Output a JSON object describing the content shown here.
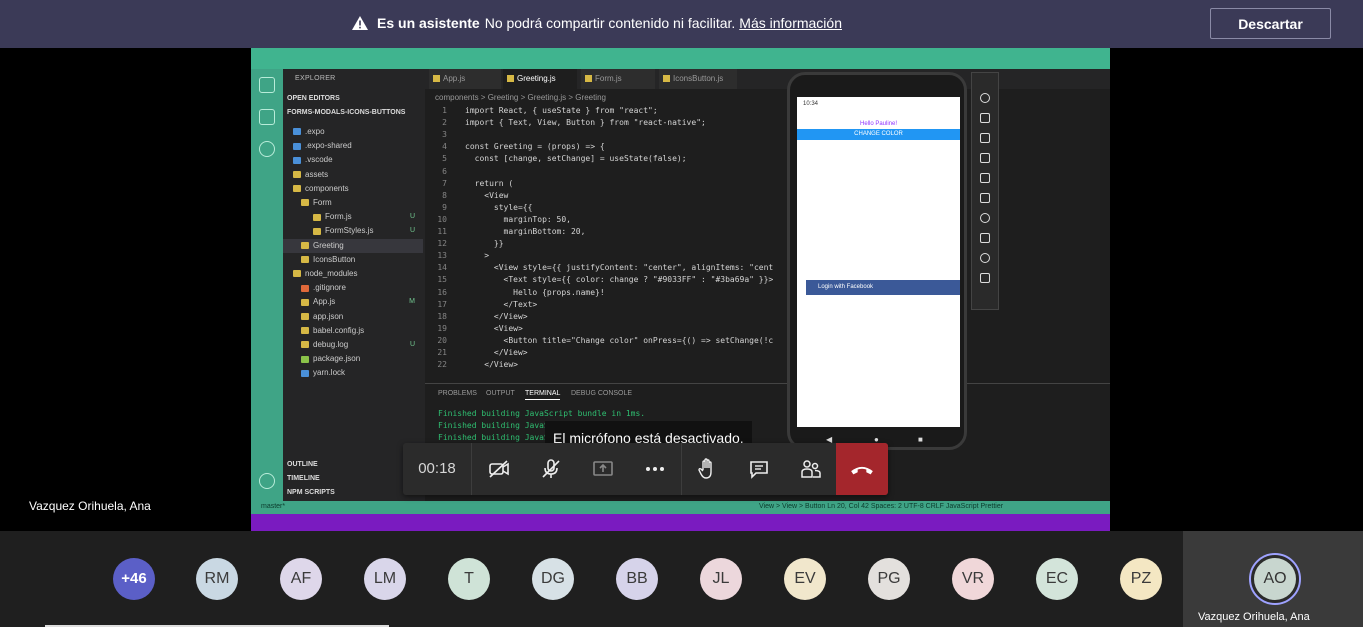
{
  "banner": {
    "icon": "warning-icon",
    "bold": "Es un asistente",
    "message": "No podrá compartir contenido ni facilitar.",
    "link": "Más información",
    "dismiss_label": "Descartar"
  },
  "vscode": {
    "explorer_title": "EXPLORER",
    "open_editors": "OPEN EDITORS",
    "project": "FORMS-MODALS-ICONS-BUTTONS",
    "tree": [
      {
        "label": ".expo",
        "status": "",
        "color": "#4a90d9"
      },
      {
        "label": ".expo-shared",
        "status": "",
        "color": "#4a90d9"
      },
      {
        "label": ".vscode",
        "status": "",
        "color": "#4a90d9"
      },
      {
        "label": "assets",
        "status": "",
        "color": "#d6b845"
      },
      {
        "label": "components",
        "status": "",
        "color": "#d6b845"
      },
      {
        "label": "Form",
        "status": "",
        "color": "#d6b845"
      },
      {
        "label": "Form.js",
        "status": "U",
        "color": "#d6b845"
      },
      {
        "label": "FormStyles.js",
        "status": "U",
        "color": "#d6b845"
      },
      {
        "label": "Greeting",
        "status": "",
        "color": "#d6b845"
      },
      {
        "label": "IconsButton",
        "status": "",
        "color": "#d6b845"
      },
      {
        "label": "node_modules",
        "status": "",
        "color": "#d6b845"
      },
      {
        "label": ".gitignore",
        "status": "",
        "color": "#e0693a"
      },
      {
        "label": "App.js",
        "status": "M",
        "color": "#d6b845"
      },
      {
        "label": "app.json",
        "status": "",
        "color": "#d6b845"
      },
      {
        "label": "babel.config.js",
        "status": "",
        "color": "#d6b845"
      },
      {
        "label": "debug.log",
        "status": "U",
        "color": "#d6b845"
      },
      {
        "label": "package.json",
        "status": "",
        "color": "#8bc34a"
      },
      {
        "label": "yarn.lock",
        "status": "",
        "color": "#4a90d9"
      }
    ],
    "bottom_sections": [
      "OUTLINE",
      "TIMELINE",
      "NPM SCRIPTS"
    ],
    "tabs": [
      "App.js",
      "Greeting.js",
      "Form.js",
      "IconsButton.js"
    ],
    "breadcrumb": "components > Greeting > Greeting.js > Greeting",
    "code": [
      "import React, { useState } from \"react\";",
      "import { Text, View, Button } from \"react-native\";",
      "",
      "const Greeting = (props) => {",
      "  const [change, setChange] = useState(false);",
      "",
      "  return (",
      "    <View",
      "      style={{",
      "        marginTop: 50,",
      "        marginBottom: 20,",
      "      }}",
      "    >",
      "      <View style={{ justifyContent: \"center\", alignItems: \"cent",
      "        <Text style={{ color: change ? \"#9033FF\" : \"#3ba69a\" }}>",
      "          Hello {props.name}!",
      "        </Text>",
      "      </View>",
      "      <View>",
      "        <Button title=\"Change color\" onPress={() => setChange(!c",
      "      </View>",
      "    </View>"
    ],
    "panel_tabs": [
      "PROBLEMS",
      "OUTPUT",
      "TERMINAL",
      "DEBUG CONSOLE"
    ],
    "terminal": [
      "Finished building JavaScript bundle in 1ms.",
      "Finished building JavaScript bundle in 0ms.",
      "Finished building JavaScript bundle in 1ms."
    ],
    "status_left": "master*",
    "status_right": "View > View > Button    Ln 20, Col 42    Spaces: 2    UTF-8    CRLF    JavaScript    Prettier"
  },
  "phone": {
    "time": "10:34",
    "hello": "Hello Pauline!",
    "change_button": "CHANGE COLOR",
    "facebook_button": "Login with Facebook"
  },
  "caption": "El micrófono está desactivado.",
  "controls": {
    "timer": "00:18"
  },
  "presenter_name": "Vazquez Orihuela, Ana",
  "participants": {
    "more": "+46",
    "avatars": [
      {
        "initials": "RM",
        "color": "#c9d8e3"
      },
      {
        "initials": "AF",
        "color": "#ded7ea"
      },
      {
        "initials": "LM",
        "color": "#d9d6ea"
      },
      {
        "initials": "T",
        "color": "#cfe3d7"
      },
      {
        "initials": "DG",
        "color": "#d7e1e6"
      },
      {
        "initials": "BB",
        "color": "#d6d3ea"
      },
      {
        "initials": "JL",
        "color": "#ecd7dc"
      },
      {
        "initials": "EV",
        "color": "#f1e7cc"
      },
      {
        "initials": "PG",
        "color": "#e3e0dd"
      },
      {
        "initials": "VR",
        "color": "#f0d7d9"
      },
      {
        "initials": "EC",
        "color": "#d3e4da"
      },
      {
        "initials": "PZ",
        "color": "#f4e7c3"
      }
    ],
    "self_initials": "AO",
    "self_name": "Vazquez Orihuela, Ana"
  }
}
